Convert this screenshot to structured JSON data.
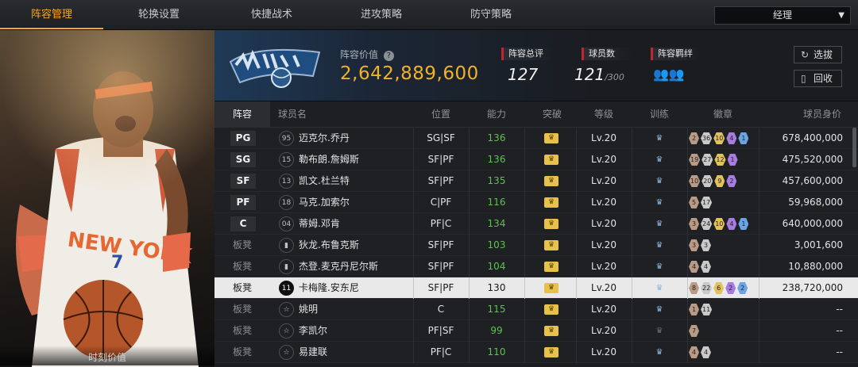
{
  "tabs": [
    {
      "label": "阵容管理",
      "active": true
    },
    {
      "label": "轮换设置",
      "active": false
    },
    {
      "label": "快捷战术",
      "active": false
    },
    {
      "label": "进攻策略",
      "active": false
    },
    {
      "label": "防守策略",
      "active": false
    }
  ],
  "manager_dropdown": {
    "value": "经理"
  },
  "hero": {
    "caption": "时刻价值"
  },
  "summary": {
    "lineup_value_label": "阵容价值",
    "lineup_value": "2,642,889,600",
    "total_rating_label": "阵容总评",
    "total_rating": "127",
    "player_count_label": "球员数",
    "player_count": "121",
    "player_count_max": "/300",
    "bond_label": "阵容羁绊",
    "pick_button": "选拔",
    "recycle_button": "回收"
  },
  "table": {
    "headers": [
      "阵容",
      "球员名",
      "位置",
      "能力",
      "突破",
      "等级",
      "训练",
      "徽章",
      "球员身价"
    ],
    "rows": [
      {
        "slot": "PG",
        "slot_style": "pos",
        "num": "95",
        "jersey": "dark-num",
        "name": "迈克尔.乔丹",
        "position": "SG|SF",
        "ability": "136",
        "level": "Lv.20",
        "train": "blue",
        "badges": [
          "2",
          "36",
          "10",
          "4",
          "1"
        ],
        "worth": "678,400,000"
      },
      {
        "slot": "SG",
        "slot_style": "pos",
        "num": "15",
        "jersey": "num",
        "name": "勒布朗.詹姆斯",
        "position": "SF|PF",
        "ability": "136",
        "level": "Lv.20",
        "train": "blue",
        "badges": [
          "19",
          "27",
          "12",
          "1"
        ],
        "worth": "475,520,000"
      },
      {
        "slot": "SF",
        "slot_style": "pos",
        "num": "13",
        "jersey": "num",
        "name": "凯文.杜兰特",
        "position": "SF|PF",
        "ability": "135",
        "level": "Lv.20",
        "train": "blue",
        "badges": [
          "10",
          "20",
          "9",
          "2"
        ],
        "worth": "457,600,000"
      },
      {
        "slot": "PF",
        "slot_style": "pos",
        "num": "18",
        "jersey": "num",
        "name": "马克.加索尔",
        "position": "C|PF",
        "ability": "116",
        "level": "Lv.20",
        "train": "blue",
        "badges": [
          "5",
          "17"
        ],
        "worth": "59,968,000"
      },
      {
        "slot": "C",
        "slot_style": "pos",
        "num": "04",
        "jersey": "num",
        "name": "蒂姆.邓肯",
        "position": "PF|C",
        "ability": "134",
        "level": "Lv.20",
        "train": "blue",
        "badges": [
          "3",
          "24",
          "10",
          "4",
          "1"
        ],
        "worth": "640,000,000"
      },
      {
        "slot": "板凳",
        "slot_style": "bench",
        "num": "",
        "jersey": "bars",
        "name": "狄龙.布鲁克斯",
        "position": "SF|PF",
        "ability": "103",
        "level": "Lv.20",
        "train": "blue",
        "badges": [
          "3",
          "3"
        ],
        "worth": "3,001,600"
      },
      {
        "slot": "板凳",
        "slot_style": "bench",
        "num": "",
        "jersey": "bars",
        "name": "杰登.麦克丹尼尔斯",
        "position": "SF|PF",
        "ability": "104",
        "level": "Lv.20",
        "train": "blue",
        "badges": [
          "4",
          "4"
        ],
        "worth": "10,880,000"
      },
      {
        "slot": "板凳",
        "slot_style": "bench",
        "num": "11",
        "jersey": "dark",
        "name": "卡梅隆.安东尼",
        "position": "SF|PF",
        "ability": "130",
        "level": "Lv.20",
        "train": "blue",
        "badges": [
          "8",
          "22",
          "6",
          "2",
          "2"
        ],
        "worth": "238,720,000",
        "selected": true
      },
      {
        "slot": "板凳",
        "slot_style": "bench",
        "num": "",
        "jersey": "star",
        "name": "姚明",
        "position": "C",
        "ability": "115",
        "level": "Lv.20",
        "train": "blue",
        "badges": [
          "1",
          "11"
        ],
        "worth": "--"
      },
      {
        "slot": "板凳",
        "slot_style": "bench",
        "num": "",
        "jersey": "star",
        "name": "李凯尔",
        "position": "PF|SF",
        "ability": "99",
        "level": "Lv.20",
        "train": "gray",
        "badges": [
          "7"
        ],
        "worth": "--"
      },
      {
        "slot": "板凳",
        "slot_style": "bench",
        "num": "",
        "jersey": "star",
        "name": "易建联",
        "position": "PF|C",
        "ability": "110",
        "level": "Lv.20",
        "train": "blue",
        "badges": [
          "4",
          "4"
        ],
        "worth": "--"
      }
    ]
  },
  "colors": {
    "accent": "#f5a623",
    "ability": "#5cc24f",
    "value": "#f2b12a"
  },
  "icons": [
    "help-icon",
    "bond-icon",
    "refresh-icon",
    "recycle-icon",
    "crown-icon",
    "train-icon"
  ]
}
